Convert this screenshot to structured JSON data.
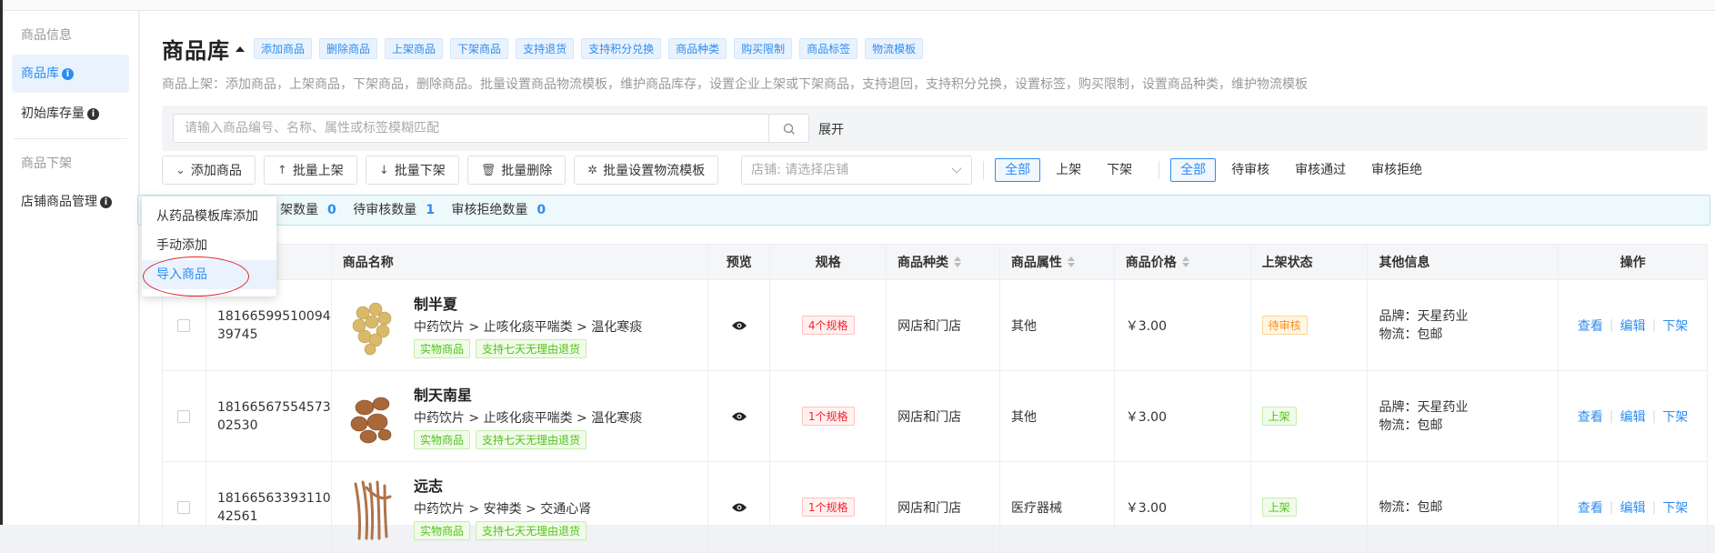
{
  "sidebar": {
    "group1": "商品信息",
    "items1": [
      {
        "label": "商品库",
        "info": "i"
      },
      {
        "label": "初始库存量",
        "info": "i"
      }
    ],
    "group2": "商品下架",
    "items2": [
      {
        "label": "店铺商品管理",
        "info": "i"
      }
    ]
  },
  "header": {
    "title": "商品库",
    "tags": [
      "添加商品",
      "删除商品",
      "上架商品",
      "下架商品",
      "支持退货",
      "支持积分兑换",
      "商品种类",
      "购买限制",
      "商品标签",
      "物流模板"
    ],
    "description": "商品上架：添加商品，上架商品，下架商品，删除商品。批量设置商品物流模板，维护商品库存，设置企业上架或下架商品，支持退回，支持积分兑换，设置标签，购买限制，设置商品种类，维护物流模板"
  },
  "search": {
    "placeholder": "请输入商品编号、名称、属性或标签模糊匹配",
    "expand": "展开"
  },
  "toolbar": {
    "add": "添加商品",
    "batch_on": "批量上架",
    "batch_off": "批量下架",
    "batch_delete": "批量删除",
    "batch_logistics": "批量设置物流模板",
    "shop_select": "店铺:  请选择店铺",
    "shelf_filter": [
      "全部",
      "上架",
      "下架"
    ],
    "audit_filter": [
      "全部",
      "待审核",
      "审核通过",
      "审核拒绝"
    ]
  },
  "counts": {
    "label1": "架数量",
    "value1": "0",
    "label2": "待审核数量",
    "value2": "1",
    "label3": "审核拒绝数量",
    "value3": "0"
  },
  "dropdown": {
    "items": [
      "从药品模板库添加",
      "手动添加",
      "导入商品"
    ]
  },
  "table": {
    "headers": {
      "name": "商品名称",
      "preview": "预览",
      "spec": "规格",
      "kind": "商品种类",
      "attr": "商品属性",
      "price": "商品价格",
      "state": "上架状态",
      "other": "其他信息",
      "ops": "操作"
    },
    "rows": [
      {
        "id": "18166599510094 39745",
        "name": "制半夏",
        "category": "中药饮片 > 止咳化痰平喘类 > 温化寒痰",
        "tags": [
          "实物商品",
          "支持七天无理由退货"
        ],
        "spec": "4个规格",
        "kind": "网店和门店",
        "attr": "其他",
        "price": "￥3.00",
        "state": "待审核",
        "brand": "品牌：天星药业",
        "logistics": "物流：包邮",
        "ops": [
          "查看",
          "编辑",
          "下架"
        ]
      },
      {
        "id": "18166567554573 02530",
        "name": "制天南星",
        "category": "中药饮片 > 止咳化痰平喘类 > 温化寒痰",
        "tags": [
          "实物商品",
          "支持七天无理由退货"
        ],
        "spec": "1个规格",
        "kind": "网店和门店",
        "attr": "其他",
        "price": "￥3.00",
        "state": "上架",
        "brand": "品牌：天星药业",
        "logistics": "物流：包邮",
        "ops": [
          "查看",
          "编辑",
          "下架"
        ]
      },
      {
        "id": "18166563393110 42561",
        "name": "远志",
        "category": "中药饮片 > 安神类 > 交通心肾",
        "tags": [
          "实物商品",
          "支持七天无理由退货"
        ],
        "spec": "1个规格",
        "kind": "网店和门店",
        "attr": "医疗器械",
        "price": "￥3.00",
        "state": "上架",
        "brand": "",
        "logistics": "物流：包邮",
        "ops": [
          "查看",
          "编辑",
          "下架"
        ]
      }
    ]
  }
}
